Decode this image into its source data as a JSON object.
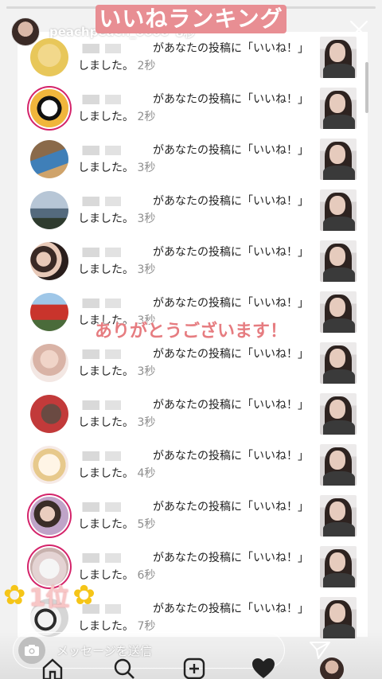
{
  "story": {
    "progress": 0.62,
    "username": "peachpeach_o608",
    "time_ago": "8秒",
    "title": "いいねランキング",
    "thanks": "ありがとうございます！",
    "rank": "1位"
  },
  "notifications": [
    {
      "text": "があなたの投稿に「いいね！」しました。",
      "time": "2秒"
    },
    {
      "text": "があなたの投稿に「いいね！」しました。",
      "time": "2秒"
    },
    {
      "text": "があなたの投稿に「いいね！」しました。",
      "time": "3秒"
    },
    {
      "text": "があなたの投稿に「いいね！」しました。",
      "time": "3秒"
    },
    {
      "text": "があなたの投稿に「いいね！」しました。",
      "time": "3秒"
    },
    {
      "text": "があなたの投稿に「いいね！」しました。",
      "time": "3秒"
    },
    {
      "text": "があなたの投稿に「いいね！」しました。",
      "time": "3秒"
    },
    {
      "text": "があなたの投稿に「いいね！」しました。",
      "time": "3秒"
    },
    {
      "text": "があなたの投稿に「いいね！」しました。",
      "time": "4秒"
    },
    {
      "text": "があなたの投稿に「いいね！」しました。",
      "time": "5秒"
    },
    {
      "text": "があなたの投稿に「いいね！」しました。",
      "time": "6秒"
    },
    {
      "text": "があなたの投稿に「いいね！」しました。",
      "time": "7秒"
    }
  ],
  "reply": {
    "placeholder": "メッセージを送信"
  },
  "colors": {
    "banner": "#e88e93",
    "thanks": "#e67c80",
    "story_ring": "#d4236a",
    "flower": "#f5c518"
  },
  "icons": [
    "close-icon",
    "camera-icon",
    "send-icon",
    "home-icon",
    "search-icon",
    "add-icon",
    "heart-icon",
    "flower-icon"
  ]
}
